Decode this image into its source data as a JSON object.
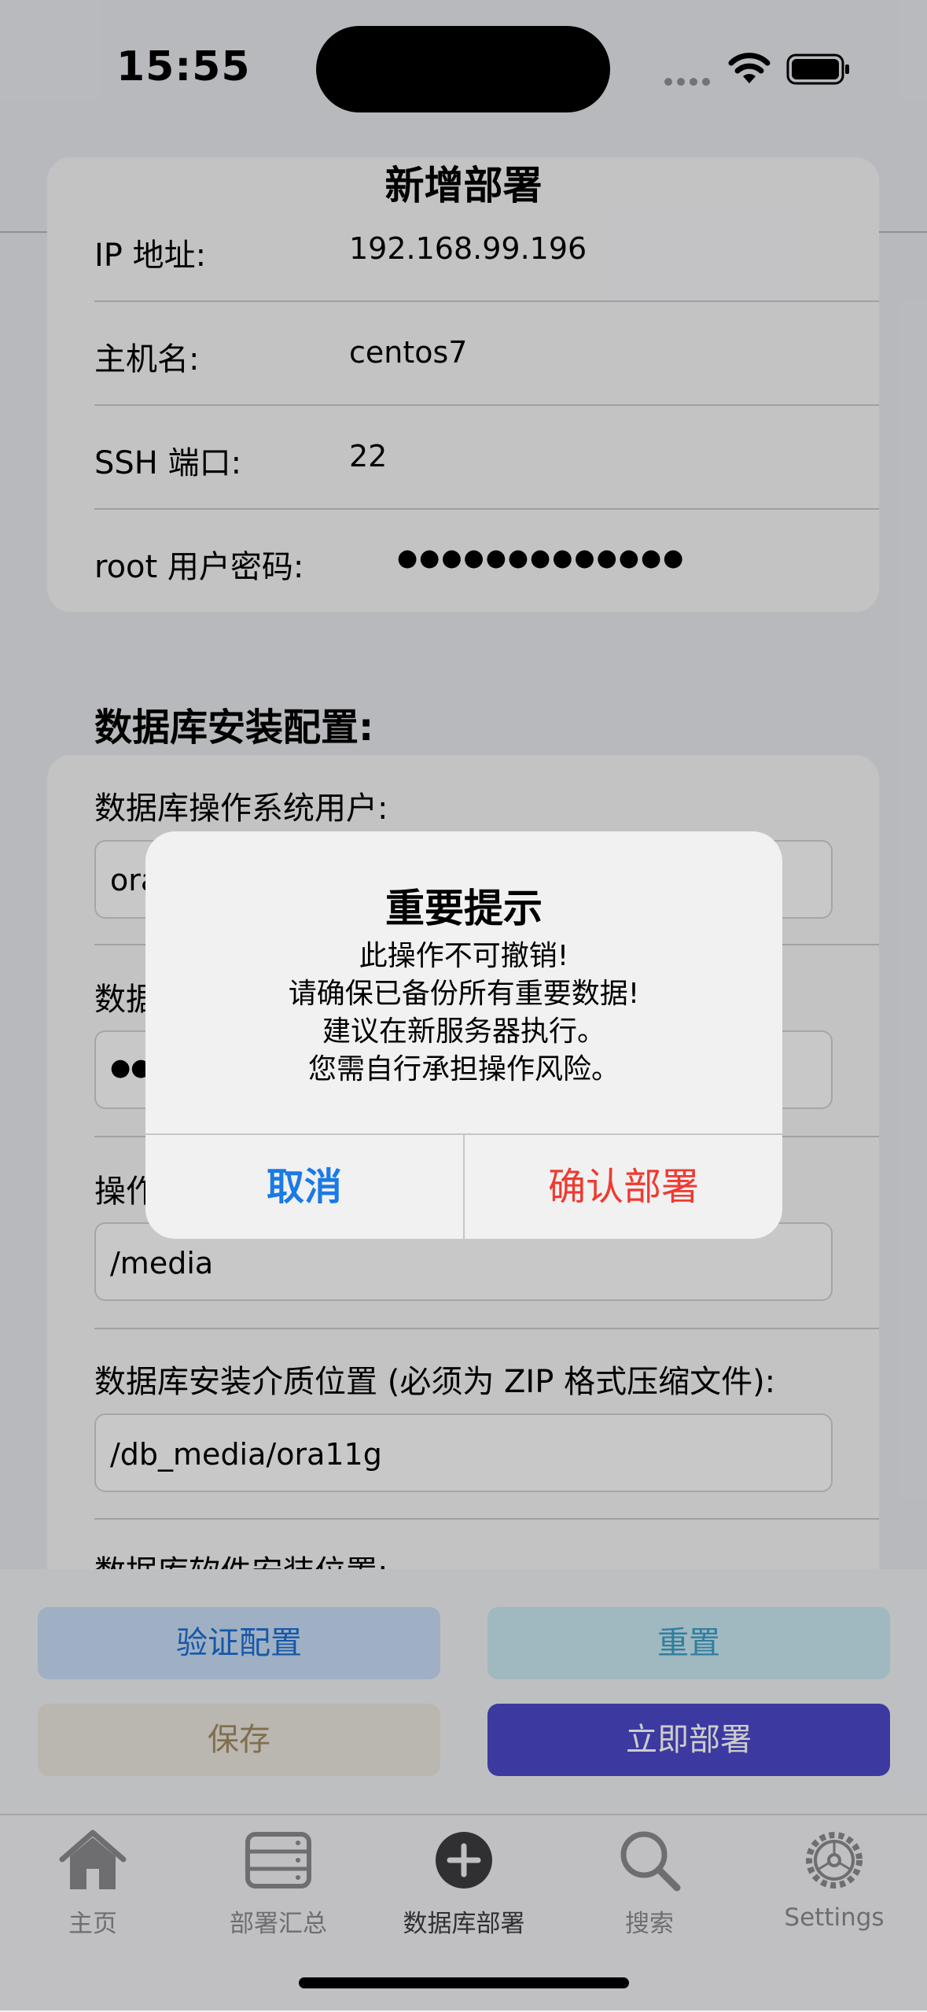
{
  "status": {
    "time": "15:55"
  },
  "nav": {
    "title": "新增部署"
  },
  "host_config": {
    "rows": [
      {
        "label": "IP 地址:",
        "value": "192.168.99.196"
      },
      {
        "label": "主机名:",
        "value": "centos7"
      },
      {
        "label": "SSH 端口:",
        "value": "22"
      },
      {
        "label": "root 用户密码:",
        "value": "●●●●●●●●●●●●●"
      }
    ]
  },
  "db_config": {
    "section_title": "数据库安装配置:",
    "fields": [
      {
        "label": "数据库操作系统用户:",
        "value": "ora"
      },
      {
        "label": "数据",
        "value": "●●"
      },
      {
        "label": "操作",
        "value": "/media"
      },
      {
        "label": "数据库安装介质位置 (必须为 ZIP 格式压缩文件):",
        "value": "/db_media/ora11g"
      },
      {
        "label": "数据库软件安装位置:",
        "value": ""
      }
    ]
  },
  "buttons": {
    "verify": "验证配置",
    "reset": "重置",
    "save": "保存",
    "deploy": "立即部署"
  },
  "tabs": [
    {
      "label": "主页",
      "icon": "house-icon"
    },
    {
      "label": "部署汇总",
      "icon": "server-rack-icon"
    },
    {
      "label": "数据库部署",
      "icon": "plus-circle-icon"
    },
    {
      "label": "搜索",
      "icon": "magnifier-icon"
    },
    {
      "label": "Settings",
      "icon": "gear-icon"
    }
  ],
  "alert": {
    "title": "重要提示",
    "lines": [
      "此操作不可撤销!",
      "请确保已备份所有重要数据!",
      "建议在新服务器执行。",
      "您需自行承担操作风险。"
    ],
    "cancel": "取消",
    "confirm": "确认部署"
  },
  "colors": {
    "accent_blue": "#1a7ae6",
    "danger_red": "#ee3b30",
    "deploy_indigo": "#4b49c9"
  }
}
